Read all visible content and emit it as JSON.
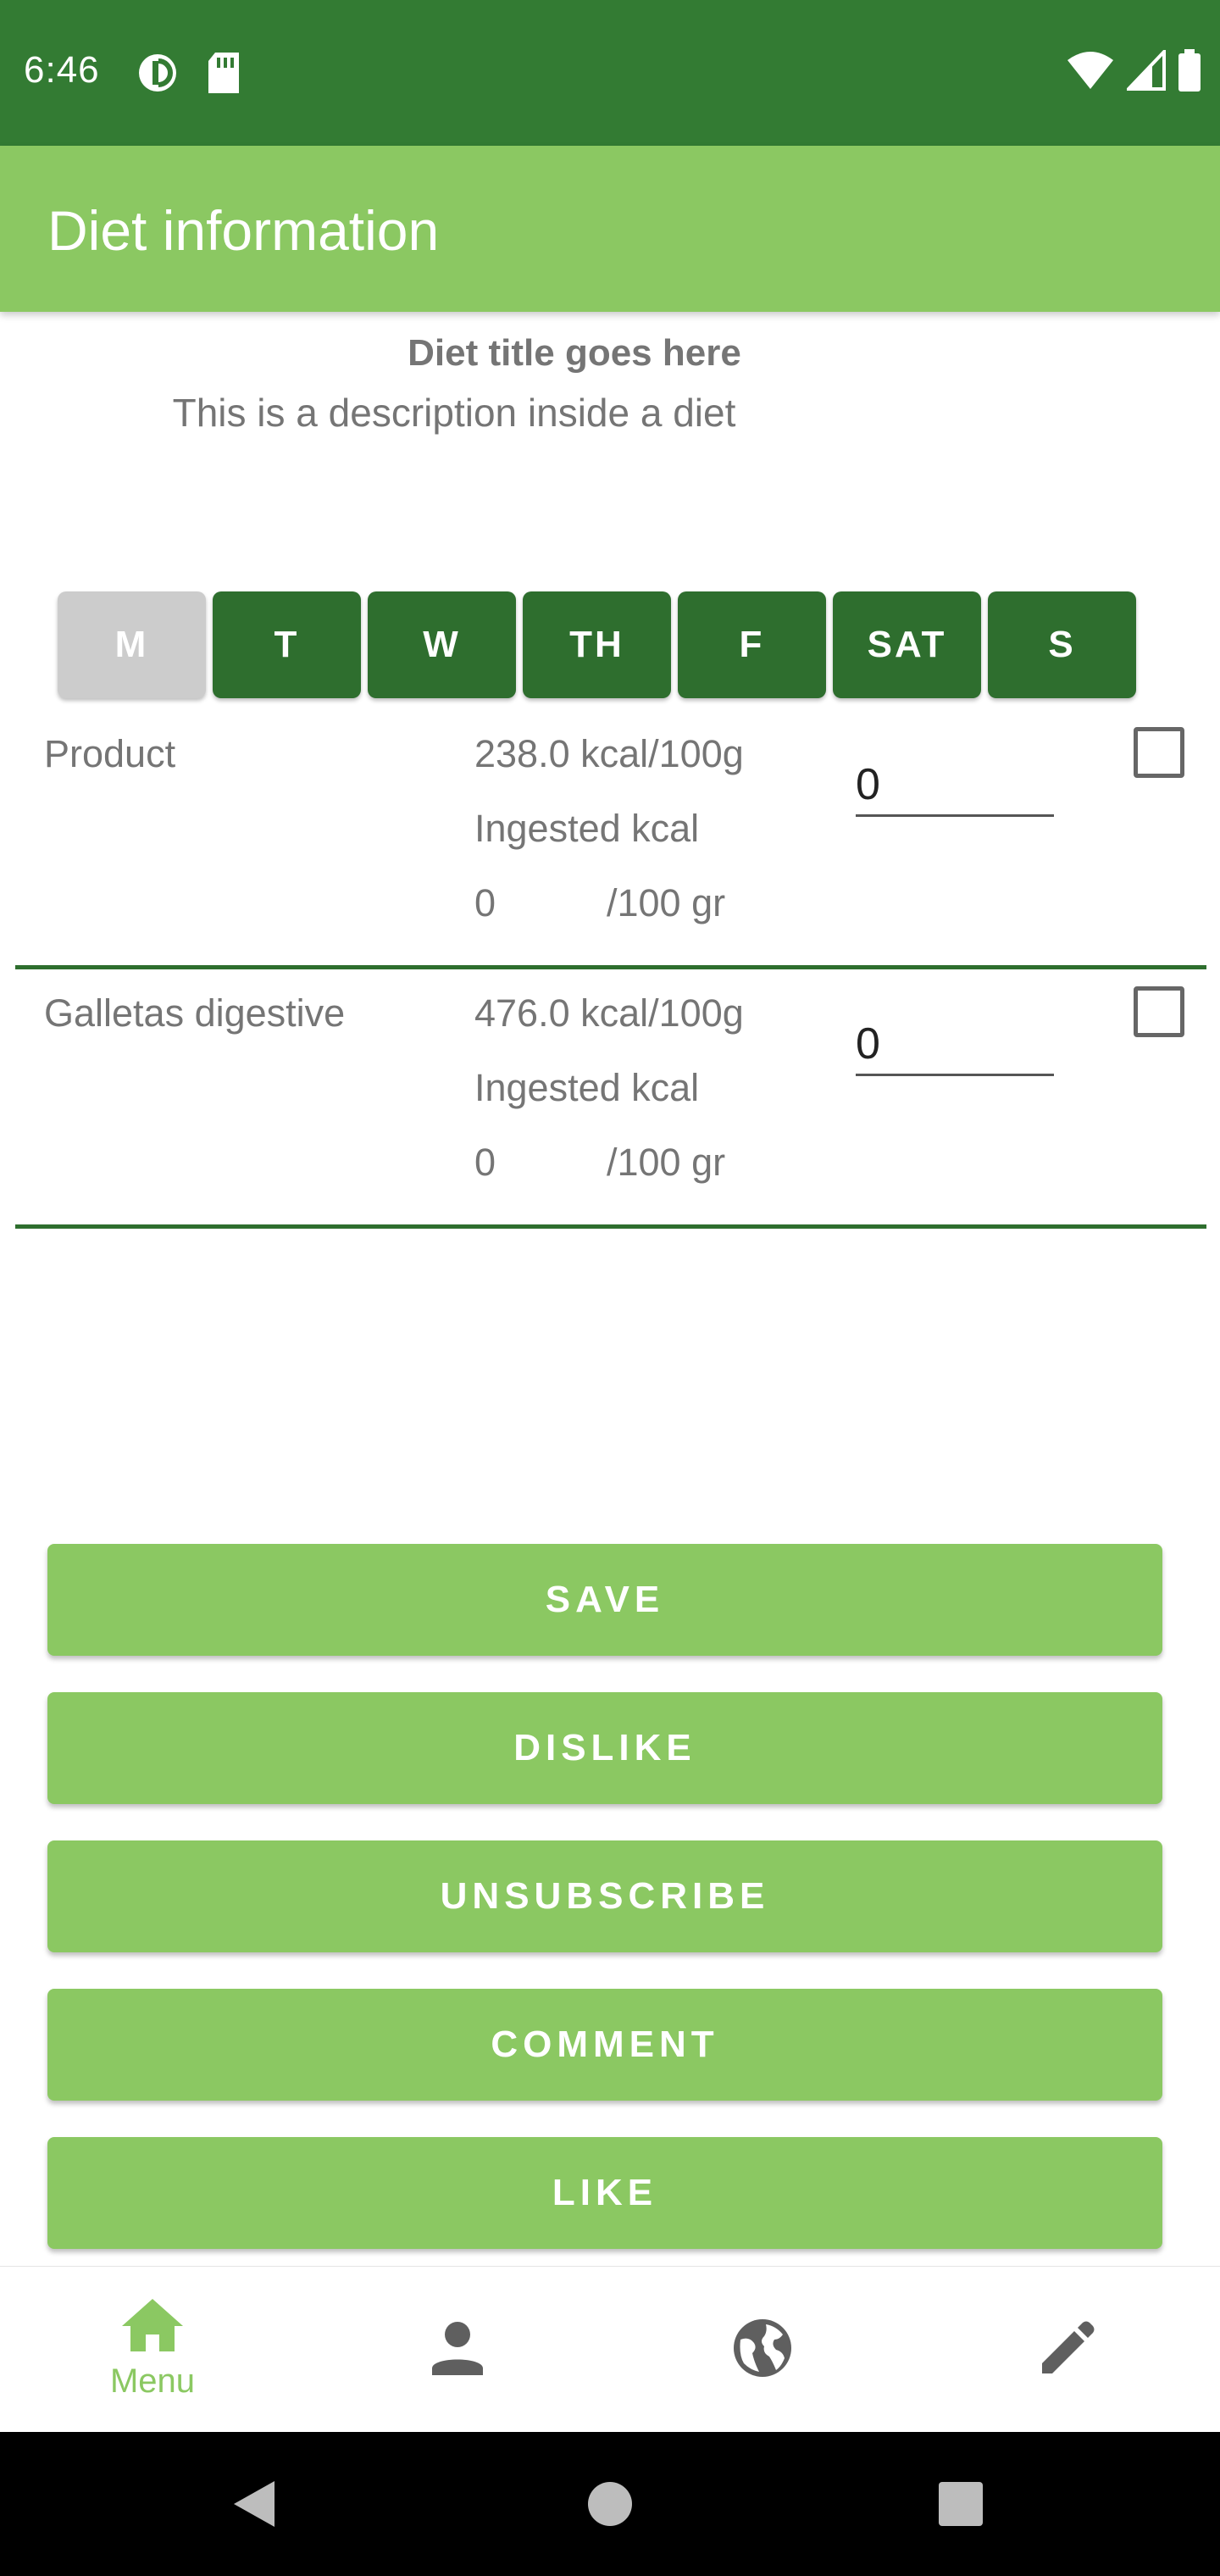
{
  "status_bar": {
    "time": "6:46",
    "icons_left": [
      "data-saver-icon",
      "sd-card-icon"
    ],
    "icons_right": [
      "wifi-icon",
      "signal-icon",
      "battery-icon"
    ]
  },
  "app_bar": {
    "title": "Diet information"
  },
  "diet": {
    "title": "Diet title goes here",
    "description": "This is a description inside a diet"
  },
  "days": [
    {
      "label": "M",
      "selected": true
    },
    {
      "label": "T",
      "selected": false
    },
    {
      "label": "W",
      "selected": false
    },
    {
      "label": "TH",
      "selected": false
    },
    {
      "label": "F",
      "selected": false
    },
    {
      "label": "SAT",
      "selected": false
    },
    {
      "label": "S",
      "selected": false
    }
  ],
  "products": [
    {
      "name": "Product",
      "kcal": "238.0 kcal/100g",
      "ingested_label": "Ingested kcal",
      "ingested_value": "0",
      "per_unit": "/100 gr",
      "amount": "0",
      "checked": false
    },
    {
      "name": "Galletas digestive",
      "kcal": "476.0 kcal/100g",
      "ingested_label": "Ingested kcal",
      "ingested_value": "0",
      "per_unit": "/100 gr",
      "amount": "0",
      "checked": false
    }
  ],
  "actions": {
    "save": "SAVE",
    "dislike": "DISLIKE",
    "unsubscribe": "UNSUBSCRIBE",
    "comment": "COMMENT",
    "like": "LIKE"
  },
  "bottom_nav": {
    "items": [
      {
        "icon": "home-icon",
        "label": "Menu",
        "active": true
      },
      {
        "icon": "person-icon",
        "label": "",
        "active": false
      },
      {
        "icon": "globe-icon",
        "label": "",
        "active": false
      },
      {
        "icon": "edit-pencil-icon",
        "label": "",
        "active": false
      }
    ]
  },
  "colors": {
    "status_bar": "#337b33",
    "app_bar": "#8bc862",
    "day_button": "#2e6e2e",
    "day_selected": "#cccccc",
    "accent": "#8bc862",
    "divider": "#2e6e2e"
  }
}
